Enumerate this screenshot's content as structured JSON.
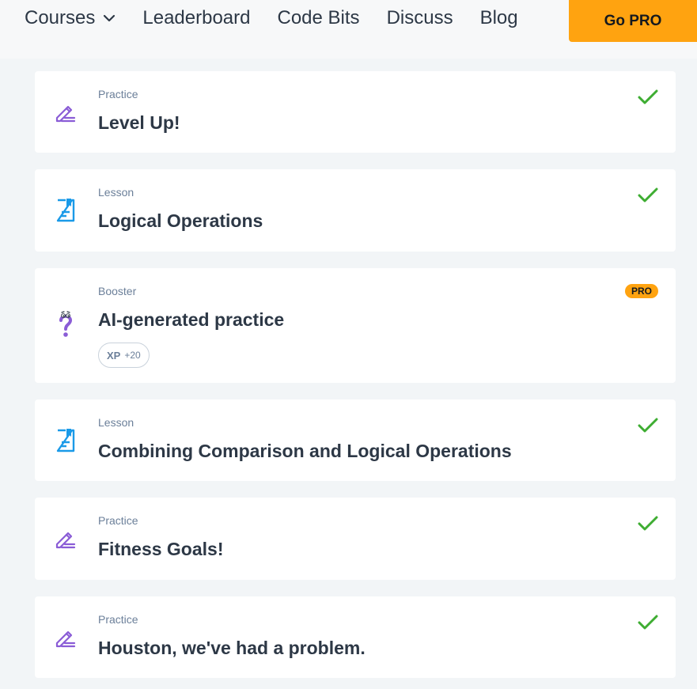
{
  "nav": {
    "items": [
      "Courses",
      "Leaderboard",
      "Code Bits",
      "Discuss",
      "Blog"
    ],
    "go_pro": "Go PRO"
  },
  "colors": {
    "accent": "#ffa310",
    "practice_icon": "#8a5cd6",
    "lesson_icon": "#1a9ae8",
    "check": "#3ead32"
  },
  "cards": [
    {
      "type": "Practice",
      "title": "Level Up!",
      "icon": "pencil-icon",
      "status": "completed"
    },
    {
      "type": "Lesson",
      "title": "Logical Operations",
      "icon": "lesson-icon",
      "status": "completed"
    },
    {
      "type": "Booster",
      "title": "AI-generated practice",
      "icon": "question-mark-icon",
      "badge": "PRO",
      "xp_label": "XP",
      "xp_value": "+20"
    },
    {
      "type": "Lesson",
      "title": "Combining Comparison and Logical Operations",
      "icon": "lesson-icon",
      "status": "completed"
    },
    {
      "type": "Practice",
      "title": "Fitness Goals!",
      "icon": "pencil-icon",
      "status": "completed"
    },
    {
      "type": "Practice",
      "title": "Houston, we've had a problem.",
      "icon": "pencil-icon",
      "status": "completed"
    }
  ]
}
